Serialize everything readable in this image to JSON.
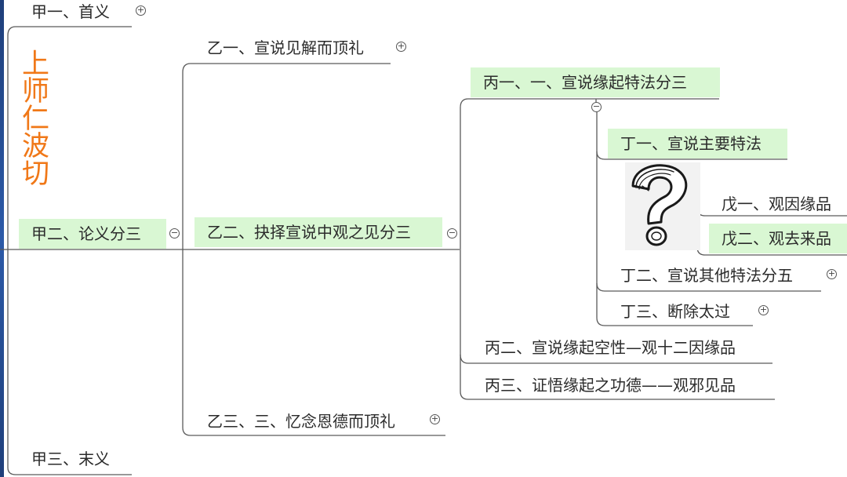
{
  "title_vertical": "上师仁波切",
  "nodes": {
    "jia1": "甲一、首义",
    "jia2": "甲二、论义分三",
    "jia3": "甲三、末义",
    "yi1": "乙一、宣说见解而顶礼",
    "yi2": "乙二、抉择宣说中观之见分三",
    "yi3": "乙三、三、忆念恩德而顶礼",
    "bing1": "丙一、一、宣说缘起特法分三",
    "bing2": "丙二、宣说缘起空性—观十二因缘品",
    "bing3": "丙三、证悟缘起之功德——观邪见品",
    "ding1": "丁一、宣说主要特法",
    "ding2": "丁二、宣说其他特法分五",
    "ding3": "丁三、断除太过",
    "wu1": "戊一、观因缘品",
    "wu2": "戊二、观去来品"
  },
  "toggles": {
    "expand": "+",
    "collapse": "−"
  },
  "colors": {
    "highlight": "#d9f7d3",
    "title": "#f07818",
    "line": "#555555",
    "frame": "#2c5aa8"
  },
  "icons": {
    "image": "question-mark-image"
  }
}
